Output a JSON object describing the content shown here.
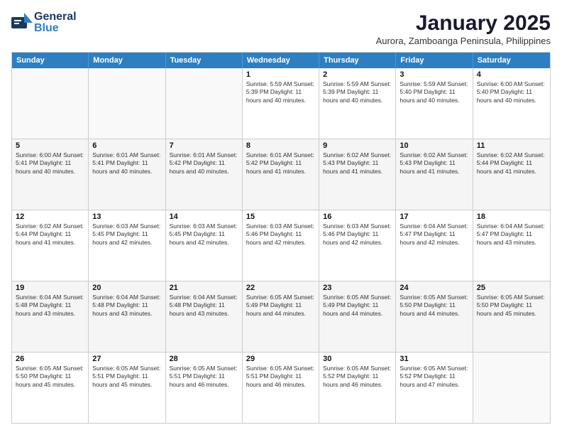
{
  "header": {
    "logo_general": "General",
    "logo_blue": "Blue",
    "month_title": "January 2025",
    "subtitle": "Aurora, Zamboanga Peninsula, Philippines"
  },
  "days_of_week": [
    "Sunday",
    "Monday",
    "Tuesday",
    "Wednesday",
    "Thursday",
    "Friday",
    "Saturday"
  ],
  "weeks": [
    [
      {
        "day": "",
        "info": ""
      },
      {
        "day": "",
        "info": ""
      },
      {
        "day": "",
        "info": ""
      },
      {
        "day": "1",
        "info": "Sunrise: 5:59 AM\nSunset: 5:39 PM\nDaylight: 11 hours\nand 40 minutes."
      },
      {
        "day": "2",
        "info": "Sunrise: 5:59 AM\nSunset: 5:39 PM\nDaylight: 11 hours\nand 40 minutes."
      },
      {
        "day": "3",
        "info": "Sunrise: 5:59 AM\nSunset: 5:40 PM\nDaylight: 11 hours\nand 40 minutes."
      },
      {
        "day": "4",
        "info": "Sunrise: 6:00 AM\nSunset: 5:40 PM\nDaylight: 11 hours\nand 40 minutes."
      }
    ],
    [
      {
        "day": "5",
        "info": "Sunrise: 6:00 AM\nSunset: 5:41 PM\nDaylight: 11 hours\nand 40 minutes."
      },
      {
        "day": "6",
        "info": "Sunrise: 6:01 AM\nSunset: 5:41 PM\nDaylight: 11 hours\nand 40 minutes."
      },
      {
        "day": "7",
        "info": "Sunrise: 6:01 AM\nSunset: 5:42 PM\nDaylight: 11 hours\nand 40 minutes."
      },
      {
        "day": "8",
        "info": "Sunrise: 6:01 AM\nSunset: 5:42 PM\nDaylight: 11 hours\nand 41 minutes."
      },
      {
        "day": "9",
        "info": "Sunrise: 6:02 AM\nSunset: 5:43 PM\nDaylight: 11 hours\nand 41 minutes."
      },
      {
        "day": "10",
        "info": "Sunrise: 6:02 AM\nSunset: 5:43 PM\nDaylight: 11 hours\nand 41 minutes."
      },
      {
        "day": "11",
        "info": "Sunrise: 6:02 AM\nSunset: 5:44 PM\nDaylight: 11 hours\nand 41 minutes."
      }
    ],
    [
      {
        "day": "12",
        "info": "Sunrise: 6:02 AM\nSunset: 5:44 PM\nDaylight: 11 hours\nand 41 minutes."
      },
      {
        "day": "13",
        "info": "Sunrise: 6:03 AM\nSunset: 5:45 PM\nDaylight: 11 hours\nand 42 minutes."
      },
      {
        "day": "14",
        "info": "Sunrise: 6:03 AM\nSunset: 5:45 PM\nDaylight: 11 hours\nand 42 minutes."
      },
      {
        "day": "15",
        "info": "Sunrise: 6:03 AM\nSunset: 5:46 PM\nDaylight: 11 hours\nand 42 minutes."
      },
      {
        "day": "16",
        "info": "Sunrise: 6:03 AM\nSunset: 5:46 PM\nDaylight: 11 hours\nand 42 minutes."
      },
      {
        "day": "17",
        "info": "Sunrise: 6:04 AM\nSunset: 5:47 PM\nDaylight: 11 hours\nand 42 minutes."
      },
      {
        "day": "18",
        "info": "Sunrise: 6:04 AM\nSunset: 5:47 PM\nDaylight: 11 hours\nand 43 minutes."
      }
    ],
    [
      {
        "day": "19",
        "info": "Sunrise: 6:04 AM\nSunset: 5:48 PM\nDaylight: 11 hours\nand 43 minutes."
      },
      {
        "day": "20",
        "info": "Sunrise: 6:04 AM\nSunset: 5:48 PM\nDaylight: 11 hours\nand 43 minutes."
      },
      {
        "day": "21",
        "info": "Sunrise: 6:04 AM\nSunset: 5:48 PM\nDaylight: 11 hours\nand 43 minutes."
      },
      {
        "day": "22",
        "info": "Sunrise: 6:05 AM\nSunset: 5:49 PM\nDaylight: 11 hours\nand 44 minutes."
      },
      {
        "day": "23",
        "info": "Sunrise: 6:05 AM\nSunset: 5:49 PM\nDaylight: 11 hours\nand 44 minutes."
      },
      {
        "day": "24",
        "info": "Sunrise: 6:05 AM\nSunset: 5:50 PM\nDaylight: 11 hours\nand 44 minutes."
      },
      {
        "day": "25",
        "info": "Sunrise: 6:05 AM\nSunset: 5:50 PM\nDaylight: 11 hours\nand 45 minutes."
      }
    ],
    [
      {
        "day": "26",
        "info": "Sunrise: 6:05 AM\nSunset: 5:50 PM\nDaylight: 11 hours\nand 45 minutes."
      },
      {
        "day": "27",
        "info": "Sunrise: 6:05 AM\nSunset: 5:51 PM\nDaylight: 11 hours\nand 45 minutes."
      },
      {
        "day": "28",
        "info": "Sunrise: 6:05 AM\nSunset: 5:51 PM\nDaylight: 11 hours\nand 46 minutes."
      },
      {
        "day": "29",
        "info": "Sunrise: 6:05 AM\nSunset: 5:51 PM\nDaylight: 11 hours\nand 46 minutes."
      },
      {
        "day": "30",
        "info": "Sunrise: 6:05 AM\nSunset: 5:52 PM\nDaylight: 11 hours\nand 46 minutes."
      },
      {
        "day": "31",
        "info": "Sunrise: 6:05 AM\nSunset: 5:52 PM\nDaylight: 11 hours\nand 47 minutes."
      },
      {
        "day": "",
        "info": ""
      }
    ]
  ]
}
